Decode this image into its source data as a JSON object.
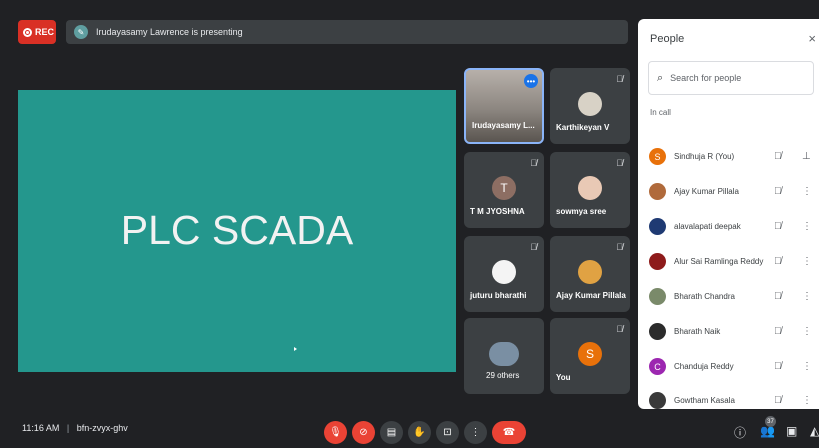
{
  "top": {
    "rec_label": "REC",
    "presenting_text": "Irudayasamy Lawrence is presenting"
  },
  "stage": {
    "slide_title": "PLC SCADA"
  },
  "tiles": [
    {
      "name": "Irudayasamy L..."
    },
    {
      "name": "Karthikeyan V"
    },
    {
      "name": "T M JYOSHNA",
      "initial": "T"
    },
    {
      "name": "sowmya sree"
    },
    {
      "name": "juturu bharathi"
    },
    {
      "name": "Ajay Kumar Pillala"
    },
    {
      "name": "29 others"
    },
    {
      "name": "You",
      "initial": "S"
    }
  ],
  "people": {
    "title": "People",
    "close": "×",
    "search_placeholder": "Search for people",
    "section_label": "In call",
    "rows": [
      {
        "name": "Sindhuja R (You)",
        "initial": "S",
        "color": "#e8710a"
      },
      {
        "name": "Ajay Kumar Pillala",
        "initial": "",
        "color": "#b06a3b"
      },
      {
        "name": "alavalapati deepak",
        "initial": "",
        "color": "#1f3a73"
      },
      {
        "name": "Alur Sai Ramlinga Reddy",
        "initial": "",
        "color": "#8e1b1b"
      },
      {
        "name": "Bharath Chandra",
        "initial": "",
        "color": "#7a8a6a"
      },
      {
        "name": "Bharath Naik",
        "initial": "",
        "color": "#2b2b2b"
      },
      {
        "name": "Chanduja Reddy",
        "initial": "C",
        "color": "#9c27b0"
      },
      {
        "name": "Gowtham Kasala",
        "initial": "",
        "color": "#3a3a3a"
      }
    ]
  },
  "bottom": {
    "time": "11:16 AM",
    "separator": "|",
    "meeting_code": "bfn-zvyx-ghv",
    "participant_count": "37"
  },
  "colors": {
    "stage": "#24978d",
    "danger": "#ea4335",
    "panel": "#ffffff"
  }
}
